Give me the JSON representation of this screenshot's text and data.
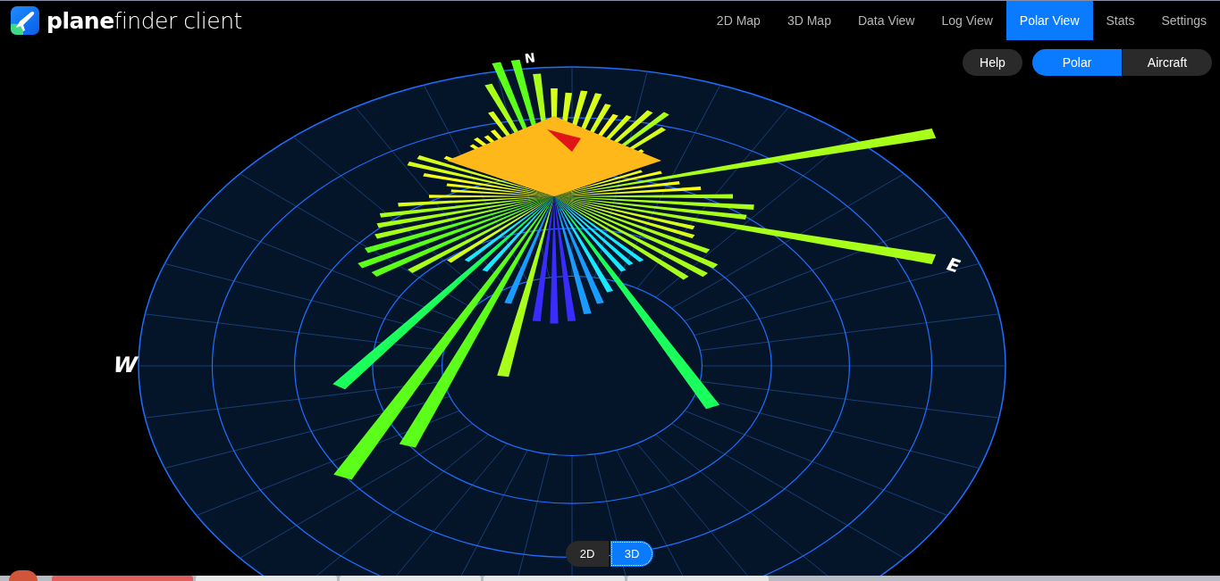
{
  "brand": {
    "name": "**plane**finder client"
  },
  "nav": [
    {
      "label": "2D Map",
      "selected": false
    },
    {
      "label": "3D Map",
      "selected": false
    },
    {
      "label": "Data View",
      "selected": false
    },
    {
      "label": "Log View",
      "selected": false
    },
    {
      "label": "Polar View",
      "selected": true
    },
    {
      "label": "Stats",
      "selected": false
    },
    {
      "label": "Settings",
      "selected": false
    }
  ],
  "help_button": {
    "label": "Help"
  },
  "mode_switch": [
    {
      "label": "Polar",
      "selected": true
    },
    {
      "label": "Aircraft",
      "selected": false
    }
  ],
  "compass": [
    {
      "kind": "north",
      "label": "N"
    },
    {
      "kind": "east",
      "label": "E"
    },
    {
      "kind": "west",
      "label": "W"
    }
  ],
  "view_toggle": [
    {
      "label": "2D",
      "selected": false
    },
    {
      "label": "3D",
      "selected": true
    }
  ]
}
